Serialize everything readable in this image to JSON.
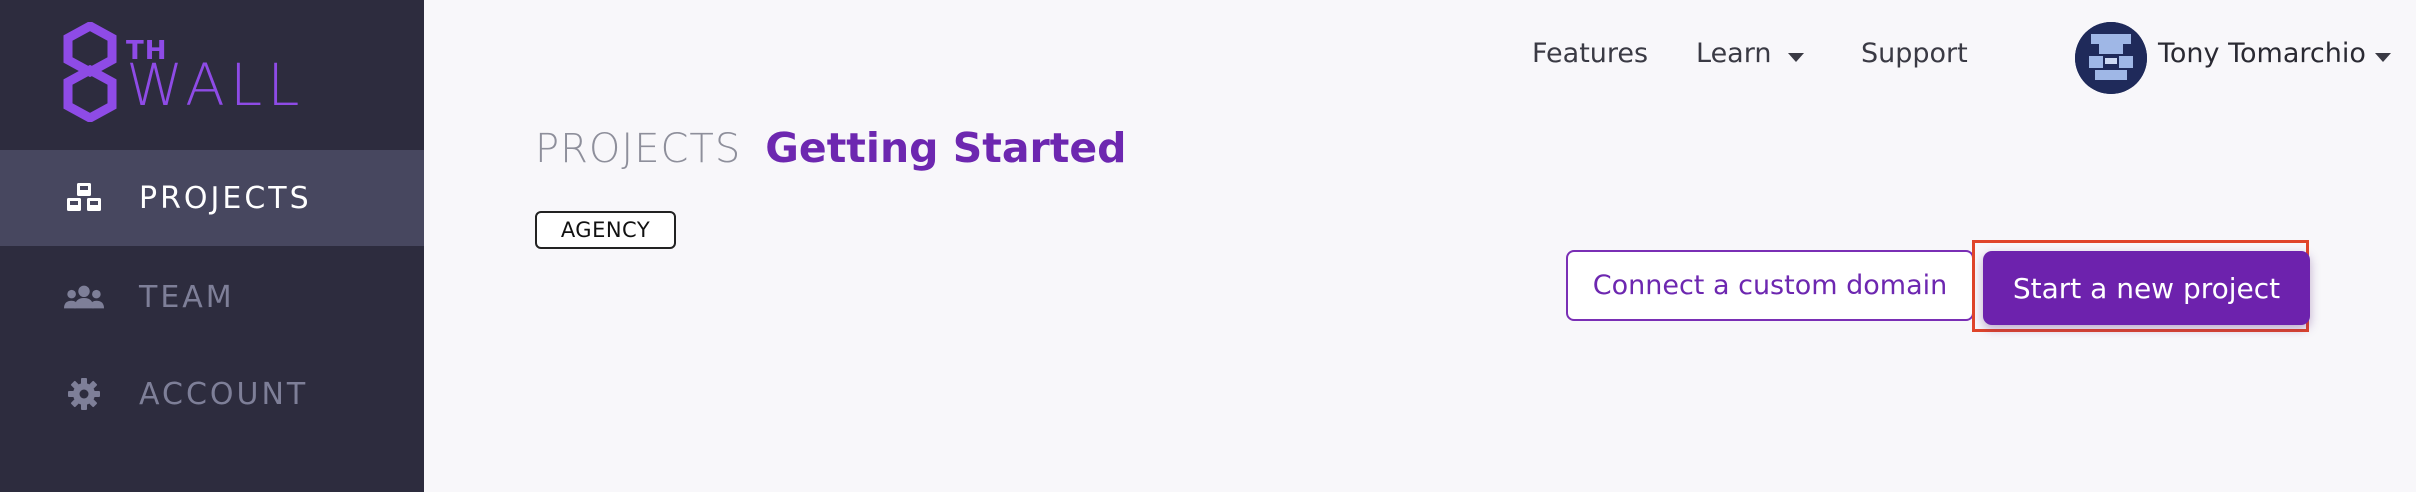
{
  "brand": {
    "logo_number": "8",
    "logo_superscript": "TH",
    "logo_word": "WALL",
    "accent_color": "#8e4be6"
  },
  "sidebar": {
    "items": [
      {
        "label": "PROJECTS",
        "icon": "cubes-icon",
        "active": true
      },
      {
        "label": "TEAM",
        "icon": "users-icon",
        "active": false
      },
      {
        "label": "ACCOUNT",
        "icon": "gear-icon",
        "active": false
      }
    ]
  },
  "topnav": {
    "features": "Features",
    "learn": "Learn",
    "support": "Support",
    "user_name": "Tony Tomarchio"
  },
  "main": {
    "heading_prefix": "PROJECTS",
    "heading_title": "Getting Started",
    "badge": "AGENCY",
    "connect_domain_label": "Connect a custom domain",
    "new_project_label": "Start a new project"
  },
  "colors": {
    "sidebar_bg": "#2d2c3e",
    "primary": "#6d22ad",
    "highlight_outline": "#e0452a"
  }
}
